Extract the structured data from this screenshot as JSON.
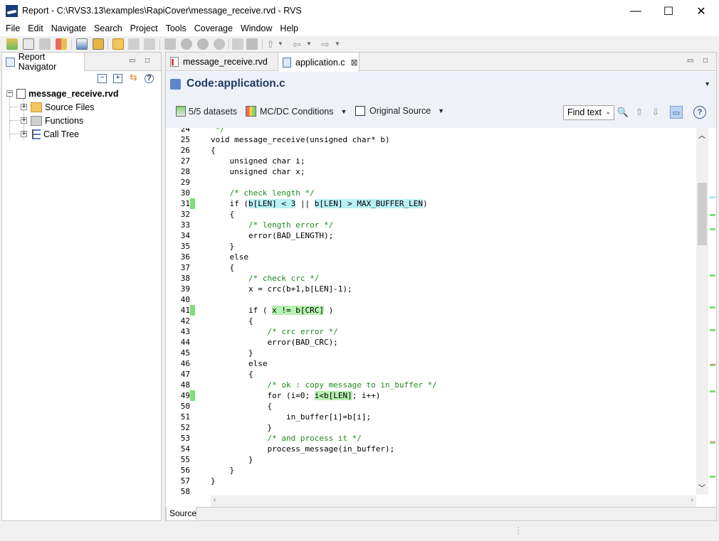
{
  "window": {
    "title": "Report - C:\\RVS3.13\\examples\\RapiCover\\message_receive.rvd - RVS",
    "minimize": "—",
    "maximize": "☐",
    "close": "✕"
  },
  "menu": [
    "File",
    "Edit",
    "Navigate",
    "Search",
    "Project",
    "Tools",
    "Coverage",
    "Window",
    "Help"
  ],
  "navigator": {
    "tab_label": "Report Navigator",
    "root": "message_receive.rvd",
    "children": [
      "Source Files",
      "Functions",
      "Call Tree"
    ]
  },
  "editor": {
    "tabs": [
      "message_receive.rvd",
      "application.c"
    ],
    "title": "Code:application.c",
    "datasets": "5/5 datasets",
    "coverage_mode": "MC/DC Conditions",
    "original_source": "Original Source",
    "find": "Find text",
    "bottom_tab": "Source"
  },
  "colors": {
    "covered": "#7ee07a",
    "partial": "#ee6a6a",
    "info": "#a9e9f2"
  },
  "code": [
    {
      "n": "24",
      "mark": "",
      "parts": [
        {
          "t": " */",
          "c": "cm"
        }
      ]
    },
    {
      "n": "25",
      "mark": "",
      "parts": [
        {
          "t": "void message_receive(unsigned char* b)"
        }
      ]
    },
    {
      "n": "26",
      "mark": "",
      "parts": [
        {
          "t": "{"
        }
      ]
    },
    {
      "n": "27",
      "mark": "",
      "parts": [
        {
          "t": "    unsigned char i;"
        }
      ]
    },
    {
      "n": "28",
      "mark": "",
      "parts": [
        {
          "t": "    unsigned char x;"
        }
      ]
    },
    {
      "n": "29",
      "mark": "",
      "parts": [
        {
          "t": ""
        }
      ]
    },
    {
      "n": "30",
      "mark": "",
      "parts": [
        {
          "t": "    /* check length */",
          "c": "cm"
        }
      ]
    },
    {
      "n": "31",
      "mark": "covered",
      "parts": [
        {
          "t": "    if ("
        },
        {
          "t": "b[LEN] < 3",
          "c": "hl-cyan"
        },
        {
          "t": " || "
        },
        {
          "t": "b[LEN] > MAX_BUFFER_LEN",
          "c": "hl-cyan"
        },
        {
          "t": ")"
        }
      ]
    },
    {
      "n": "32",
      "mark": "",
      "parts": [
        {
          "t": "    {"
        }
      ]
    },
    {
      "n": "33",
      "mark": "",
      "parts": [
        {
          "t": "        /* length error */",
          "c": "cm"
        }
      ]
    },
    {
      "n": "34",
      "mark": "",
      "parts": [
        {
          "t": "        error(BAD_LENGTH);"
        }
      ]
    },
    {
      "n": "35",
      "mark": "",
      "parts": [
        {
          "t": "    }"
        }
      ]
    },
    {
      "n": "36",
      "mark": "",
      "parts": [
        {
          "t": "    else"
        }
      ]
    },
    {
      "n": "37",
      "mark": "",
      "parts": [
        {
          "t": "    {"
        }
      ]
    },
    {
      "n": "38",
      "mark": "",
      "parts": [
        {
          "t": "        /* check crc */",
          "c": "cm"
        }
      ]
    },
    {
      "n": "39",
      "mark": "",
      "parts": [
        {
          "t": "        x = crc(b+1,b[LEN]-1);"
        }
      ]
    },
    {
      "n": "40",
      "mark": "",
      "parts": [
        {
          "t": ""
        }
      ]
    },
    {
      "n": "41",
      "mark": "covered",
      "parts": [
        {
          "t": "        if ( "
        },
        {
          "t": "x != b[CRC]",
          "c": "hl-green"
        },
        {
          "t": " )"
        }
      ]
    },
    {
      "n": "42",
      "mark": "",
      "parts": [
        {
          "t": "        {"
        }
      ]
    },
    {
      "n": "43",
      "mark": "",
      "parts": [
        {
          "t": "            /* crc error */",
          "c": "cm"
        }
      ]
    },
    {
      "n": "44",
      "mark": "",
      "parts": [
        {
          "t": "            error(BAD_CRC);"
        }
      ]
    },
    {
      "n": "45",
      "mark": "",
      "parts": [
        {
          "t": "        }"
        }
      ]
    },
    {
      "n": "46",
      "mark": "",
      "parts": [
        {
          "t": "        else"
        }
      ]
    },
    {
      "n": "47",
      "mark": "",
      "parts": [
        {
          "t": "        {"
        }
      ]
    },
    {
      "n": "48",
      "mark": "",
      "parts": [
        {
          "t": "            /* ok : copy message to in_buffer */",
          "c": "cm"
        }
      ]
    },
    {
      "n": "49",
      "mark": "covered",
      "parts": [
        {
          "t": "            for (i=0; "
        },
        {
          "t": "i<b[LEN]",
          "c": "hl-green"
        },
        {
          "t": "; i++)"
        }
      ]
    },
    {
      "n": "50",
      "mark": "",
      "parts": [
        {
          "t": "            {"
        }
      ]
    },
    {
      "n": "51",
      "mark": "",
      "parts": [
        {
          "t": "                in_buffer[i]=b[i];"
        }
      ]
    },
    {
      "n": "52",
      "mark": "",
      "parts": [
        {
          "t": "            }"
        }
      ]
    },
    {
      "n": "53",
      "mark": "",
      "parts": [
        {
          "t": "            /* and process it */",
          "c": "cm"
        }
      ]
    },
    {
      "n": "54",
      "mark": "",
      "parts": [
        {
          "t": "            process_message(in_buffer);"
        }
      ]
    },
    {
      "n": "55",
      "mark": "",
      "parts": [
        {
          "t": "        }"
        }
      ]
    },
    {
      "n": "56",
      "mark": "",
      "parts": [
        {
          "t": "    }"
        }
      ]
    },
    {
      "n": "57",
      "mark": "",
      "parts": [
        {
          "t": "}"
        }
      ]
    },
    {
      "n": "58",
      "mark": "",
      "parts": [
        {
          "t": ""
        }
      ]
    }
  ],
  "overview_marks": [
    "info",
    "covered",
    "covered",
    "covered",
    "covered",
    "covered",
    "partial",
    "covered",
    "partial",
    "covered"
  ]
}
